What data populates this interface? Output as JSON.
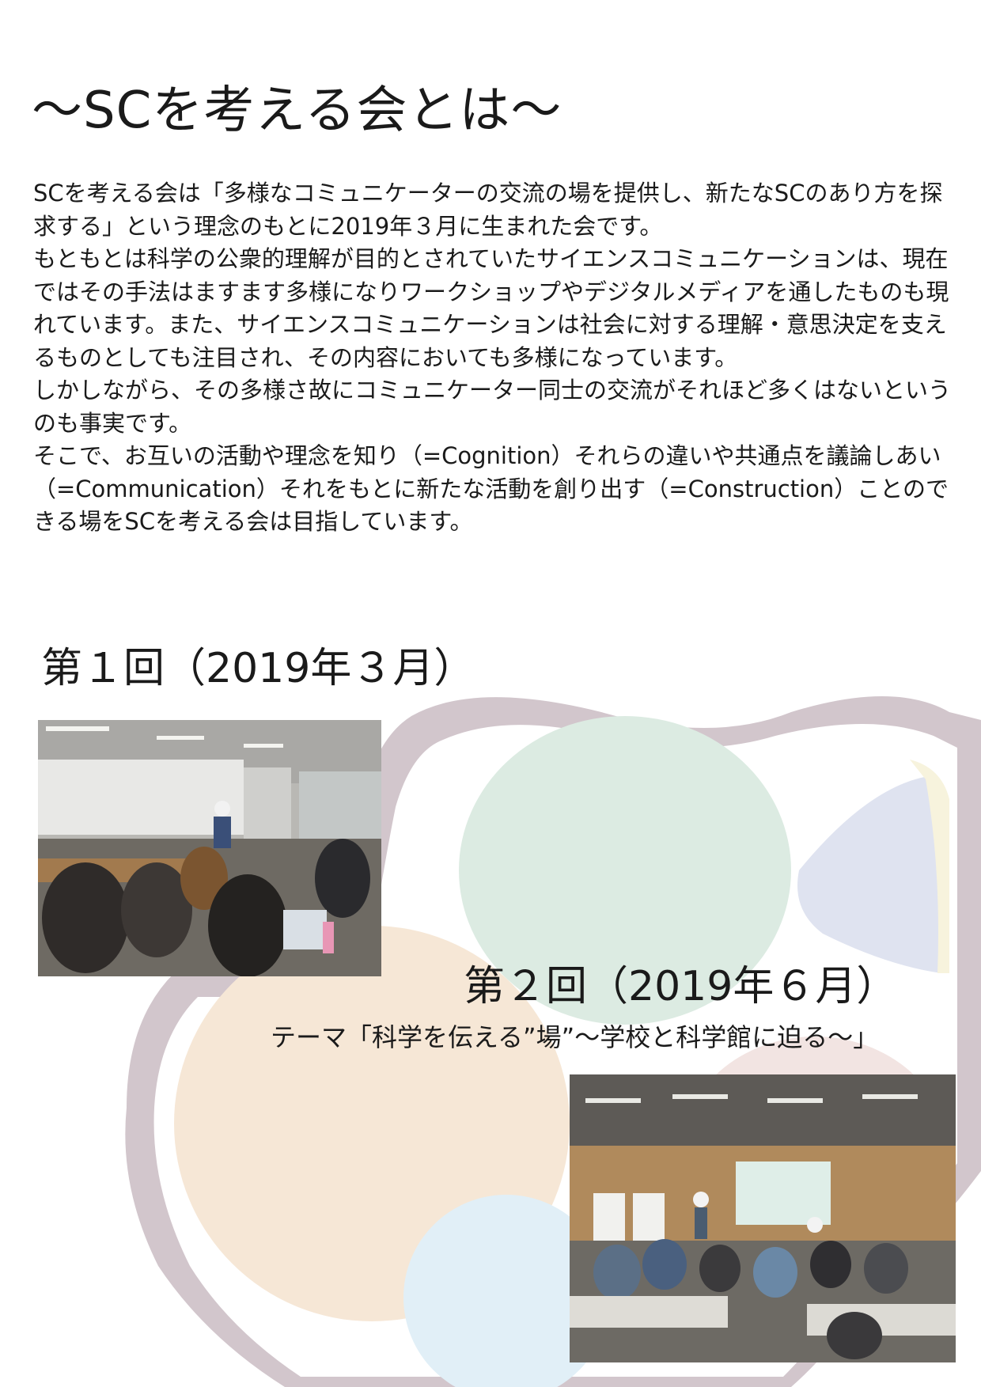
{
  "page": {
    "title": "〜SCを考える会とは〜"
  },
  "intro": {
    "paragraphs": [
      "SCを考える会は「多様なコミュニケーターの交流の場を提供し、新たなSCのあり方を探求する」という理念のもとに2019年３月に生まれた会です。",
      "もともとは科学の公衆的理解が目的とされていたサイエンスコミュニケーションは、現在ではその手法はますます多様になりワークショップやデジタルメディアを通したものも現れています。また、サイエンスコミュニケーションは社会に対する理解・意思決定を支えるものとしても注目され、その内容においても多様になっています。",
      "しかしながら、その多様さ故にコミュニケーター同士の交流がそれほど多くはないというのも事実です。",
      "そこで、お互いの活動や理念を知り（=Cognition）それらの違いや共通点を議論しあい（=Communication）それをもとに新たな活動を創り出す（=Construction）ことのできる場をSCを考える会は目指しています。"
    ]
  },
  "sessions": [
    {
      "heading": "第１回（2019年３月）"
    },
    {
      "heading": "第２回（2019年６月）",
      "theme": "テーマ「科学を伝える”場”〜学校と科学館に迫る〜」"
    }
  ],
  "colors": {
    "outer_blob": "#d2c6cc",
    "peach": "#f6e7d6",
    "mint": "#dcebe2",
    "lavender": "#dfe3f0",
    "cream": "#f7f3dd",
    "sky": "#e1eff7"
  }
}
